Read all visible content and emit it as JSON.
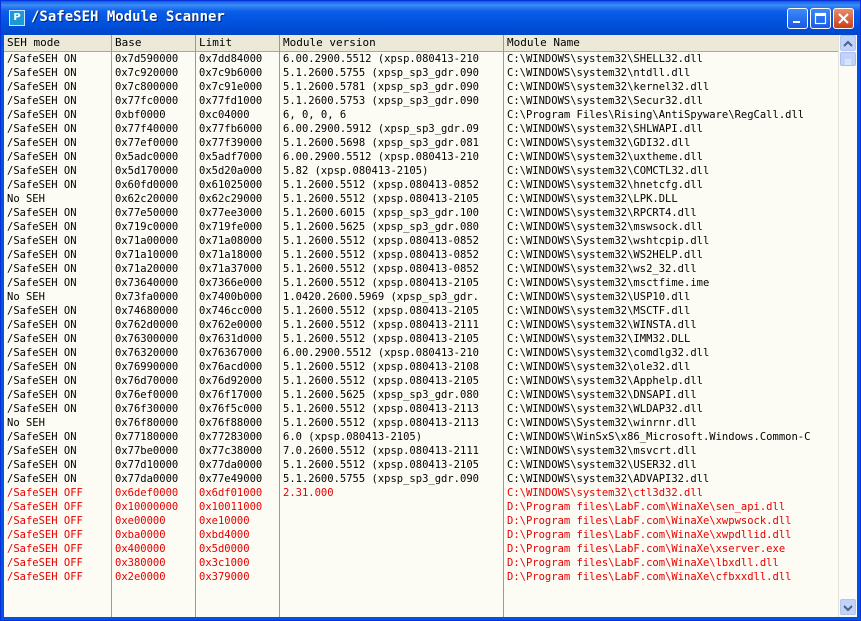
{
  "window": {
    "title": "/SafeSEH Module Scanner",
    "app_icon_letter": "P",
    "controls": {
      "minimize": "minimize-icon",
      "maximize": "maximize-icon",
      "close": "close-icon"
    }
  },
  "table": {
    "columns": [
      "SEH mode",
      "Base",
      "Limit",
      "Module version",
      "Module Name"
    ],
    "rows": [
      {
        "mode": "/SafeSEH ON",
        "base": "0x7d590000",
        "limit": "0x7dd84000",
        "version": "6.00.2900.5512 (xpsp.080413-210",
        "name": "C:\\WINDOWS\\system32\\SHELL32.dll",
        "off": false
      },
      {
        "mode": "/SafeSEH ON",
        "base": "0x7c920000",
        "limit": "0x7c9b6000",
        "version": "5.1.2600.5755 (xpsp_sp3_gdr.090",
        "name": "C:\\WINDOWS\\system32\\ntdll.dll",
        "off": false
      },
      {
        "mode": "/SafeSEH ON",
        "base": "0x7c800000",
        "limit": "0x7c91e000",
        "version": "5.1.2600.5781 (xpsp_sp3_gdr.090",
        "name": "C:\\WINDOWS\\system32\\kernel32.dll",
        "off": false
      },
      {
        "mode": "/SafeSEH ON",
        "base": "0x77fc0000",
        "limit": "0x77fd1000",
        "version": "5.1.2600.5753 (xpsp_sp3_gdr.090",
        "name": "C:\\WINDOWS\\system32\\Secur32.dll",
        "off": false
      },
      {
        "mode": "/SafeSEH ON",
        "base": "0xbf0000",
        "limit": "0xc04000",
        "version": "6, 0, 0, 6",
        "name": "C:\\Program Files\\Rising\\AntiSpyware\\RegCall.dll",
        "off": false
      },
      {
        "mode": "/SafeSEH ON",
        "base": "0x77f40000",
        "limit": "0x77fb6000",
        "version": "6.00.2900.5912 (xpsp_sp3_gdr.09",
        "name": "C:\\WINDOWS\\system32\\SHLWAPI.dll",
        "off": false
      },
      {
        "mode": "/SafeSEH ON",
        "base": "0x77ef0000",
        "limit": "0x77f39000",
        "version": "5.1.2600.5698 (xpsp_sp3_gdr.081",
        "name": "C:\\WINDOWS\\system32\\GDI32.dll",
        "off": false
      },
      {
        "mode": "/SafeSEH ON",
        "base": "0x5adc0000",
        "limit": "0x5adf7000",
        "version": "6.00.2900.5512 (xpsp.080413-210",
        "name": "C:\\WINDOWS\\system32\\uxtheme.dll",
        "off": false
      },
      {
        "mode": "/SafeSEH ON",
        "base": "0x5d170000",
        "limit": "0x5d20a000",
        "version": "5.82 (xpsp.080413-2105)",
        "name": "C:\\WINDOWS\\system32\\COMCTL32.dll",
        "off": false
      },
      {
        "mode": "/SafeSEH ON",
        "base": "0x60fd0000",
        "limit": "0x61025000",
        "version": "5.1.2600.5512 (xpsp.080413-0852",
        "name": "C:\\WINDOWS\\system32\\hnetcfg.dll",
        "off": false
      },
      {
        "mode": "No SEH",
        "base": "0x62c20000",
        "limit": "0x62c29000",
        "version": "5.1.2600.5512 (xpsp.080413-2105",
        "name": "C:\\WINDOWS\\system32\\LPK.DLL",
        "off": false
      },
      {
        "mode": "/SafeSEH ON",
        "base": "0x77e50000",
        "limit": "0x77ee3000",
        "version": "5.1.2600.6015 (xpsp_sp3_gdr.100",
        "name": "C:\\WINDOWS\\system32\\RPCRT4.dll",
        "off": false
      },
      {
        "mode": "/SafeSEH ON",
        "base": "0x719c0000",
        "limit": "0x719fe000",
        "version": "5.1.2600.5625 (xpsp_sp3_gdr.080",
        "name": "C:\\WINDOWS\\system32\\mswsock.dll",
        "off": false
      },
      {
        "mode": "/SafeSEH ON",
        "base": "0x71a00000",
        "limit": "0x71a08000",
        "version": "5.1.2600.5512 (xpsp.080413-0852",
        "name": "C:\\WINDOWS\\System32\\wshtcpip.dll",
        "off": false
      },
      {
        "mode": "/SafeSEH ON",
        "base": "0x71a10000",
        "limit": "0x71a18000",
        "version": "5.1.2600.5512 (xpsp.080413-0852",
        "name": "C:\\WINDOWS\\system32\\WS2HELP.dll",
        "off": false
      },
      {
        "mode": "/SafeSEH ON",
        "base": "0x71a20000",
        "limit": "0x71a37000",
        "version": "5.1.2600.5512 (xpsp.080413-0852",
        "name": "C:\\WINDOWS\\system32\\ws2_32.dll",
        "off": false
      },
      {
        "mode": "/SafeSEH ON",
        "base": "0x73640000",
        "limit": "0x7366e000",
        "version": "5.1.2600.5512 (xpsp.080413-2105",
        "name": "C:\\WINDOWS\\system32\\msctfime.ime",
        "off": false
      },
      {
        "mode": "No SEH",
        "base": "0x73fa0000",
        "limit": "0x7400b000",
        "version": "1.0420.2600.5969 (xpsp_sp3_gdr.",
        "name": "C:\\WINDOWS\\system32\\USP10.dll",
        "off": false
      },
      {
        "mode": "/SafeSEH ON",
        "base": "0x74680000",
        "limit": "0x746cc000",
        "version": "5.1.2600.5512 (xpsp.080413-2105",
        "name": "C:\\WINDOWS\\system32\\MSCTF.dll",
        "off": false
      },
      {
        "mode": "/SafeSEH ON",
        "base": "0x762d0000",
        "limit": "0x762e0000",
        "version": "5.1.2600.5512 (xpsp.080413-2111",
        "name": "C:\\WINDOWS\\system32\\WINSTA.dll",
        "off": false
      },
      {
        "mode": "/SafeSEH ON",
        "base": "0x76300000",
        "limit": "0x7631d000",
        "version": "5.1.2600.5512 (xpsp.080413-2105",
        "name": "C:\\WINDOWS\\system32\\IMM32.DLL",
        "off": false
      },
      {
        "mode": "/SafeSEH ON",
        "base": "0x76320000",
        "limit": "0x76367000",
        "version": "6.00.2900.5512 (xpsp.080413-210",
        "name": "C:\\WINDOWS\\system32\\comdlg32.dll",
        "off": false
      },
      {
        "mode": "/SafeSEH ON",
        "base": "0x76990000",
        "limit": "0x76acd000",
        "version": "5.1.2600.5512 (xpsp.080413-2108",
        "name": "C:\\WINDOWS\\system32\\ole32.dll",
        "off": false
      },
      {
        "mode": "/SafeSEH ON",
        "base": "0x76d70000",
        "limit": "0x76d92000",
        "version": "5.1.2600.5512 (xpsp.080413-2105",
        "name": "C:\\WINDOWS\\system32\\Apphelp.dll",
        "off": false
      },
      {
        "mode": "/SafeSEH ON",
        "base": "0x76ef0000",
        "limit": "0x76f17000",
        "version": "5.1.2600.5625 (xpsp_sp3_gdr.080",
        "name": "C:\\WINDOWS\\system32\\DNSAPI.dll",
        "off": false
      },
      {
        "mode": "/SafeSEH ON",
        "base": "0x76f30000",
        "limit": "0x76f5c000",
        "version": "5.1.2600.5512 (xpsp.080413-2113",
        "name": "C:\\WINDOWS\\system32\\WLDAP32.dll",
        "off": false
      },
      {
        "mode": "No SEH",
        "base": "0x76f80000",
        "limit": "0x76f88000",
        "version": "5.1.2600.5512 (xpsp.080413-2113",
        "name": "C:\\WINDOWS\\System32\\winrnr.dll",
        "off": false
      },
      {
        "mode": "/SafeSEH ON",
        "base": "0x77180000",
        "limit": "0x77283000",
        "version": "6.0 (xpsp.080413-2105)",
        "name": "C:\\WINDOWS\\WinSxS\\x86_Microsoft.Windows.Common-C",
        "off": false
      },
      {
        "mode": "/SafeSEH ON",
        "base": "0x77be0000",
        "limit": "0x77c38000",
        "version": "7.0.2600.5512 (xpsp.080413-2111",
        "name": "C:\\WINDOWS\\system32\\msvcrt.dll",
        "off": false
      },
      {
        "mode": "/SafeSEH ON",
        "base": "0x77d10000",
        "limit": "0x77da0000",
        "version": "5.1.2600.5512 (xpsp.080413-2105",
        "name": "C:\\WINDOWS\\system32\\USER32.dll",
        "off": false
      },
      {
        "mode": "/SafeSEH ON",
        "base": "0x77da0000",
        "limit": "0x77e49000",
        "version": "5.1.2600.5755 (xpsp_sp3_gdr.090",
        "name": "C:\\WINDOWS\\system32\\ADVAPI32.dll",
        "off": false
      },
      {
        "mode": "/SafeSEH OFF",
        "base": "0x6def0000",
        "limit": "0x6df01000",
        "version": "2.31.000",
        "name": "C:\\WINDOWS\\system32\\ctl3d32.dll",
        "off": true
      },
      {
        "mode": "/SafeSEH OFF",
        "base": "0x10000000",
        "limit": "0x10011000",
        "version": "",
        "name": "D:\\Program files\\LabF.com\\WinaXe\\sen_api.dll",
        "off": true
      },
      {
        "mode": "/SafeSEH OFF",
        "base": "0xe00000",
        "limit": "0xe10000",
        "version": "",
        "name": "D:\\Program files\\LabF.com\\WinaXe\\xwpwsock.dll",
        "off": true
      },
      {
        "mode": "/SafeSEH OFF",
        "base": "0xba0000",
        "limit": "0xbd4000",
        "version": "",
        "name": "D:\\Program files\\LabF.com\\WinaXe\\xwpdllid.dll",
        "off": true
      },
      {
        "mode": "/SafeSEH OFF",
        "base": "0x400000",
        "limit": "0x5d0000",
        "version": "",
        "name": "D:\\Program files\\LabF.com\\WinaXe\\xserver.exe",
        "off": true
      },
      {
        "mode": "/SafeSEH OFF",
        "base": "0x380000",
        "limit": "0x3c1000",
        "version": "",
        "name": "D:\\Program files\\LabF.com\\WinaXe\\lbxdll.dll",
        "off": true
      },
      {
        "mode": "/SafeSEH OFF",
        "base": "0x2e0000",
        "limit": "0x379000",
        "version": "",
        "name": "D:\\Program files\\LabF.com\\WinaXe\\cfbxxdll.dll",
        "off": true
      }
    ]
  },
  "scrollbar": {
    "up_icon": "scroll-up-icon",
    "down_icon": "scroll-down-icon"
  },
  "colors": {
    "title_bar": "#0054e3",
    "off_text": "#e80000",
    "background": "#fcfbf4"
  }
}
